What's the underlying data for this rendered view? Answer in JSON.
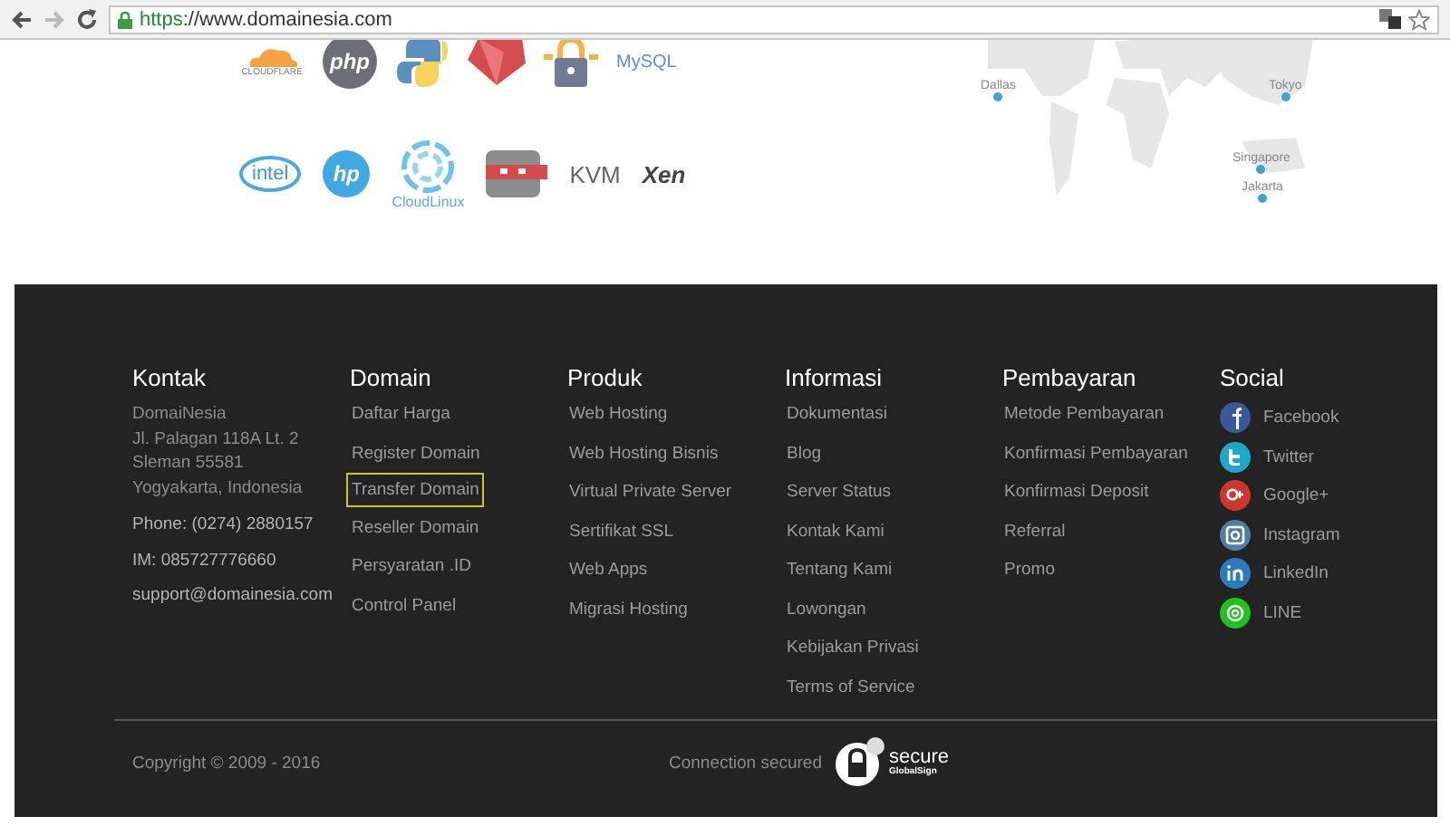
{
  "browser": {
    "url_scheme": "https",
    "url_rest": "://www.domainesia.com",
    "forward_disabled": true
  },
  "tech_logos_row_1": [
    {
      "kind": "cloudflare",
      "label": "CLOUDFLARE"
    },
    {
      "kind": "php",
      "label": "php"
    },
    {
      "kind": "python"
    },
    {
      "kind": "ruby"
    },
    {
      "kind": "lock"
    },
    {
      "kind": "mysql",
      "label": "MySQL"
    }
  ],
  "tech_logos_row_2": [
    {
      "kind": "intel",
      "label": "intel"
    },
    {
      "kind": "hp",
      "label": "hp"
    },
    {
      "kind": "cloudlinux",
      "label": "CloudLinux"
    },
    {
      "kind": "ninja"
    },
    {
      "kind": "kvm",
      "label": "KVM"
    },
    {
      "kind": "xen",
      "label": "Xen"
    }
  ],
  "map": {
    "locations": [
      {
        "name": "Dallas"
      },
      {
        "name": "Tokyo"
      },
      {
        "name": "Singapore"
      },
      {
        "name": "Jakarta"
      }
    ]
  },
  "footer": {
    "kontak": {
      "title": "Kontak",
      "address": [
        "DomaiNesia",
        "Jl. Palagan 118A Lt. 2",
        "Sleman 55581",
        "Yogyakarta, Indonesia"
      ],
      "contacts": [
        "Phone: (0274) 2880157",
        "IM: 085727776660",
        "support@domainesia.com"
      ]
    },
    "domain": {
      "title": "Domain",
      "links": [
        {
          "label": "Daftar Harga",
          "selected": false
        },
        {
          "label": "Register Domain",
          "selected": false
        },
        {
          "label": "Transfer Domain",
          "selected": true
        },
        {
          "label": "Reseller Domain",
          "selected": false
        },
        {
          "label": "Persyaratan .ID",
          "selected": false
        },
        {
          "label": "Control Panel",
          "selected": false
        }
      ]
    },
    "link_columns": [
      {
        "title": "Produk",
        "links": [
          "Web Hosting",
          "Web Hosting Bisnis",
          "Virtual Private Server",
          "Sertifikat SSL",
          "Web Apps",
          "Migrasi Hosting"
        ]
      },
      {
        "title": "Informasi",
        "links": [
          "Dokumentasi",
          "Blog",
          "Server Status",
          "Kontak Kami",
          "Tentang Kami",
          "Lowongan",
          "Kebijakan Privasi",
          "Terms of Service"
        ]
      },
      {
        "title": "Pembayaran",
        "links": [
          "Metode Pembayaran",
          "Konfirmasi Pembayaran",
          "Konfirmasi Deposit",
          "Referral",
          "Promo"
        ]
      }
    ],
    "social": {
      "title": "Social",
      "items": [
        {
          "kind": "facebook",
          "label": "Facebook",
          "color": "#3b5998"
        },
        {
          "kind": "twitter",
          "label": "Twitter",
          "color": "#1ea7c9"
        },
        {
          "kind": "googleplus",
          "label": "Google+",
          "color": "#d0352b"
        },
        {
          "kind": "instagram",
          "label": "Instagram",
          "color": "#4f7fa6"
        },
        {
          "kind": "linkedin",
          "label": "LinkedIn",
          "color": "#2d7bbf"
        },
        {
          "kind": "line",
          "label": "LINE",
          "color": "#22c21c"
        }
      ]
    },
    "copyright": "Copyright © 2009 - 2016",
    "connection": "Connection secured",
    "seal": {
      "title": "secure",
      "issuer": "GlobalSign"
    }
  }
}
